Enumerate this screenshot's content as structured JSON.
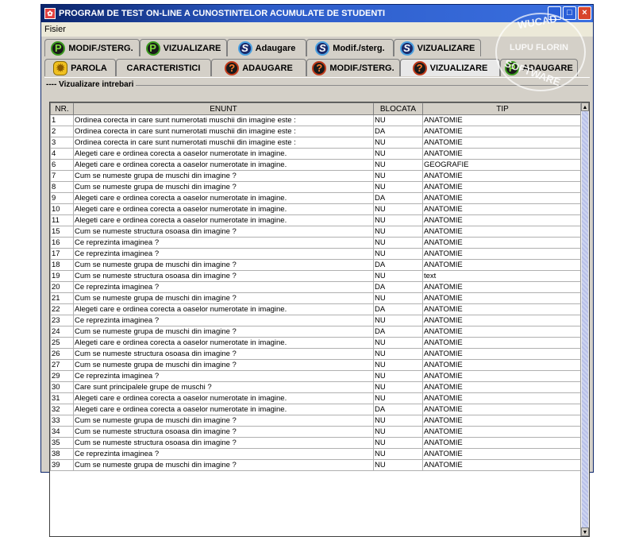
{
  "window": {
    "title": "PROGRAM DE TEST ON-LINE A CUNOSTINTELOR ACUMULATE DE STUDENTI"
  },
  "menu": {
    "file": "Fisier"
  },
  "tabs_row1": [
    {
      "label": "MODIF./STERG.",
      "icon": "p-icon"
    },
    {
      "label": "VIZUALIZARE",
      "icon": "p-icon"
    },
    {
      "label": "Adaugare",
      "icon": "s-icon"
    },
    {
      "label": "Modif./sterg.",
      "icon": "s-icon"
    },
    {
      "label": "VIZUALIZARE",
      "icon": "s-icon"
    }
  ],
  "tabs_row2": [
    {
      "label": "PAROLA",
      "icon": "star-icon"
    },
    {
      "label": "CARACTERISTICI",
      "icon": ""
    },
    {
      "label": "ADAUGARE",
      "icon": "question-icon"
    },
    {
      "label": "MODIF./STERG.",
      "icon": "question-icon"
    },
    {
      "label": "VIZUALIZARE",
      "icon": "question-icon",
      "active": true
    },
    {
      "label": "ADAUGARE",
      "icon": "p-icon"
    }
  ],
  "panel": {
    "group_title": "---- Vizualizare intrebari"
  },
  "watermark": {
    "top": "WUCAD",
    "middle": "LUPU FLORIN",
    "bottom": "SOFTWARE"
  },
  "table": {
    "columns": [
      "NR.",
      "ENUNT",
      "BLOCATA",
      "TIP"
    ],
    "rows": [
      [
        "1",
        "Ordinea corecta in care sunt numerotati muschii din imagine este :",
        "NU",
        "ANATOMIE"
      ],
      [
        "2",
        "Ordinea corecta in care sunt numerotati muschii din imagine este :",
        "DA",
        "ANATOMIE"
      ],
      [
        "3",
        "Ordinea corecta in care sunt numerotati muschii din imagine este :",
        "NU",
        "ANATOMIE"
      ],
      [
        "4",
        "Alegeti care e ordinea corecta a oaselor numerotate in imagine.",
        "NU",
        "ANATOMIE"
      ],
      [
        "6",
        "Alegeti care e ordinea corecta a oaselor numerotate in imagine.",
        "NU",
        "GEOGRAFIE"
      ],
      [
        "7",
        "Cum se numeste grupa de muschi din imagine ?",
        "NU",
        "ANATOMIE"
      ],
      [
        "8",
        "Cum se numeste grupa de muschi din imagine ?",
        "NU",
        "ANATOMIE"
      ],
      [
        "9",
        "Alegeti care e ordinea corecta a oaselor numerotate in imagine.",
        "DA",
        "ANATOMIE"
      ],
      [
        "10",
        "Alegeti care e ordinea corecta a oaselor numerotate in imagine.",
        "NU",
        "ANATOMIE"
      ],
      [
        "11",
        "Alegeti care e ordinea corecta a oaselor numerotate in imagine.",
        "NU",
        "ANATOMIE"
      ],
      [
        "15",
        "Cum se numeste structura osoasa din imagine ?",
        "NU",
        "ANATOMIE"
      ],
      [
        "16",
        "Ce reprezinta imaginea ?",
        "NU",
        "ANATOMIE"
      ],
      [
        "17",
        "Ce reprezinta imaginea ?",
        "NU",
        "ANATOMIE"
      ],
      [
        "18",
        "Cum se numeste grupa de muschi din imagine ?",
        "DA",
        "ANATOMIE"
      ],
      [
        "19",
        "Cum se numeste structura osoasa din imagine ?",
        "NU",
        "text"
      ],
      [
        "20",
        "Ce reprezinta imaginea ?",
        "DA",
        "ANATOMIE"
      ],
      [
        "21",
        "Cum se numeste grupa de muschi din imagine ?",
        "NU",
        "ANATOMIE"
      ],
      [
        "22",
        "Alegeti care e ordinea corecta a oaselor numerotate in imagine.",
        "DA",
        "ANATOMIE"
      ],
      [
        "23",
        "Ce reprezinta imaginea ?",
        "NU",
        "ANATOMIE"
      ],
      [
        "24",
        "Cum se numeste grupa de muschi din imagine ?",
        "DA",
        "ANATOMIE"
      ],
      [
        "25",
        "Alegeti care e ordinea corecta a oaselor numerotate in imagine.",
        "NU",
        "ANATOMIE"
      ],
      [
        "26",
        "Cum se numeste structura osoasa din imagine ?",
        "NU",
        "ANATOMIE"
      ],
      [
        "27",
        "Cum se numeste grupa de muschi din imagine ?",
        "NU",
        "ANATOMIE"
      ],
      [
        "29",
        "Ce reprezinta imaginea ?",
        "NU",
        "ANATOMIE"
      ],
      [
        "30",
        "Care sunt principalele grupe de muschi ?",
        "NU",
        "ANATOMIE"
      ],
      [
        "31",
        "Alegeti care e ordinea corecta a oaselor numerotate in imagine.",
        "NU",
        "ANATOMIE"
      ],
      [
        "32",
        "Alegeti care e ordinea corecta a oaselor numerotate in imagine.",
        "DA",
        "ANATOMIE"
      ],
      [
        "33",
        "Cum se numeste grupa de muschi din imagine ?",
        "NU",
        "ANATOMIE"
      ],
      [
        "34",
        "Cum se numeste structura osoasa din imagine ?",
        "NU",
        "ANATOMIE"
      ],
      [
        "35",
        "Cum se numeste structura osoasa din imagine ?",
        "NU",
        "ANATOMIE"
      ],
      [
        "38",
        "Ce reprezinta imaginea ?",
        "NU",
        "ANATOMIE"
      ],
      [
        "39",
        "Cum se numeste grupa de muschi din imagine ?",
        "NU",
        "ANATOMIE"
      ]
    ]
  },
  "colors": {
    "title_bar": "#0a246a",
    "window_bg": "#d4d0c8",
    "active_tab": "#e8e8e8",
    "close_button": "#d8452c"
  }
}
